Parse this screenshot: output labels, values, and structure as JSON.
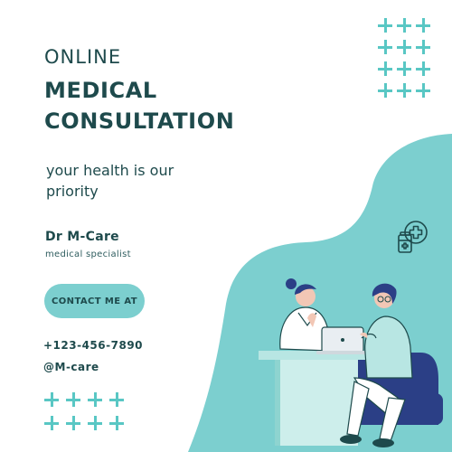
{
  "headline": {
    "line1": "ONLINE",
    "line2": "MEDICAL",
    "line3": "CONSULTATION"
  },
  "tagline": {
    "line1": "your health is our",
    "line2": "priority"
  },
  "doctor": {
    "name": "Dr M-Care",
    "role": "medical specialist"
  },
  "contact": {
    "button_label": "CONTACT ME AT",
    "phone": "+123-456-7890",
    "handle": "@M-care"
  },
  "icons": {
    "decoration": "plus-sign-icon",
    "pharmacy": "medicine-cross-icon",
    "illustration": "doctor-patient-consultation-illustration"
  },
  "colors": {
    "primary_text": "#1e4a4c",
    "accent_teal": "#7ccfcf",
    "light_teal": "#b8e6e3",
    "plus_teal": "#59c7c4",
    "navy": "#2b3f86",
    "background": "#ffffff"
  }
}
